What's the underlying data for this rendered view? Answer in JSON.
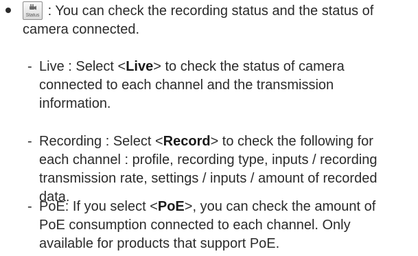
{
  "intro": {
    "button_label": "Status",
    "lines": [
      ": You can check the recording status and the status of",
      "camera connected."
    ]
  },
  "items": [
    {
      "dash": "-",
      "line1_pre": "Live : Select <",
      "keyword": "Live",
      "line1_post": "> to check the status of camera",
      "lines": [
        "connected to each channel and the transmission",
        "information."
      ]
    },
    {
      "dash": "-",
      "line1_pre": "Recording : Select <",
      "keyword": "Record",
      "line1_post": "> to check the following for",
      "lines": [
        "each channel : profile, recording type, inputs / recording",
        "transmission rate, settings / inputs / amount of recorded",
        "data."
      ]
    },
    {
      "dash": "-",
      "line1_pre": "PoE: If you select <",
      "keyword": "PoE",
      "line1_post": ">, you can check the amount of",
      "lines": [
        "PoE consumption connected to each channel. Only",
        "available for products that support PoE."
      ]
    }
  ]
}
